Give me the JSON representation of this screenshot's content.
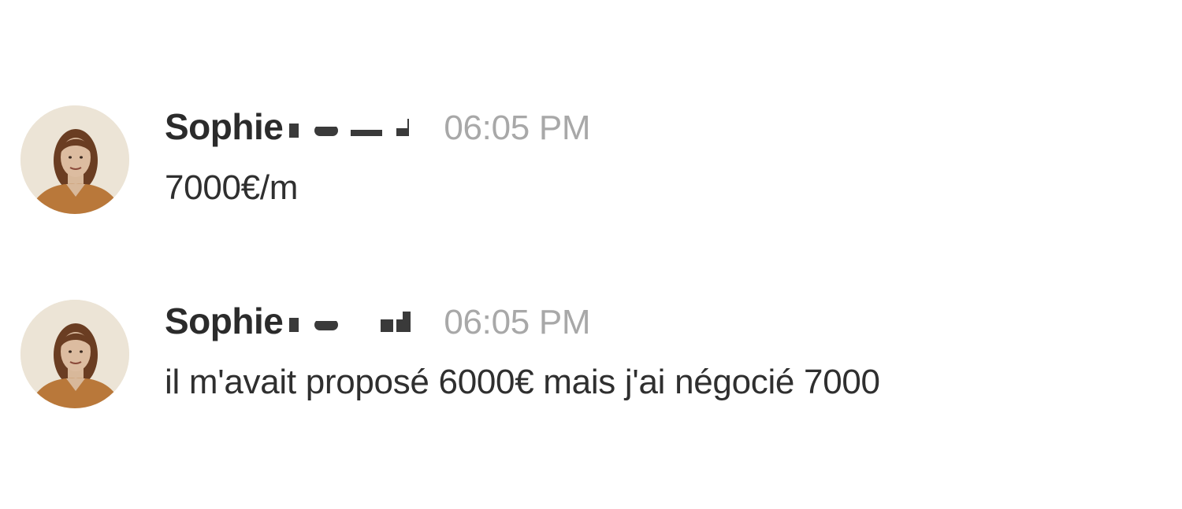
{
  "messages": [
    {
      "author": "Sophie",
      "time": "06:05 PM",
      "text": "7000€/m",
      "avatar_icon": "user-avatar-photo"
    },
    {
      "author": "Sophie",
      "time": "06:05 PM",
      "text": "il m'avait proposé 6000€ mais j'ai négocié 7000",
      "avatar_icon": "user-avatar-photo"
    }
  ],
  "colors": {
    "author": "#2b2b2b",
    "time": "#a8a8a8",
    "text": "#2f2f2f",
    "avatar_bg": "#ece4d6",
    "shirt": "#b9783a",
    "hair": "#6a3d22"
  }
}
